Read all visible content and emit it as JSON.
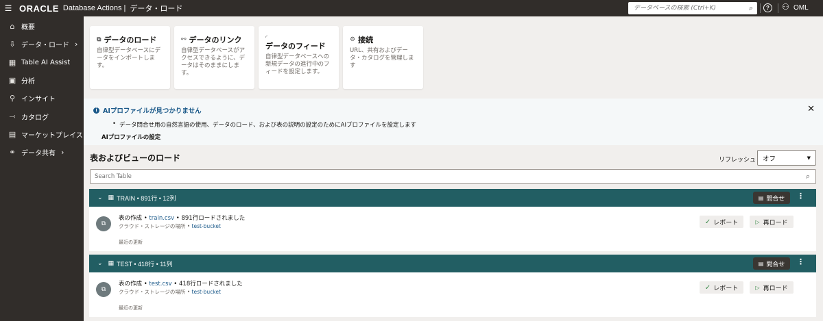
{
  "header": {
    "logo": "ORACLE",
    "product": "Database Actions |",
    "page": "データ・ロード",
    "search_placeholder": "データベースの検索 (Ctrl+K)",
    "user": "OML"
  },
  "sidebar": {
    "items": [
      {
        "label": "概要",
        "icon": "home-icon",
        "has_chevron": false
      },
      {
        "label": "データ・ロード",
        "icon": "data-load-icon",
        "has_chevron": true
      },
      {
        "label": "Table AI Assist",
        "icon": "table-ai-icon",
        "has_chevron": false
      },
      {
        "label": "分析",
        "icon": "analysis-icon",
        "has_chevron": false
      },
      {
        "label": "インサイト",
        "icon": "insight-icon",
        "has_chevron": false
      },
      {
        "label": "カタログ",
        "icon": "catalog-icon",
        "has_chevron": false
      },
      {
        "label": "マーケットプレイス",
        "icon": "marketplace-icon",
        "has_chevron": false
      },
      {
        "label": "データ共有",
        "icon": "share-icon",
        "has_chevron": true
      }
    ]
  },
  "cards": [
    {
      "title": "データのロード",
      "desc": "自律型データベースにデータをインポートします。",
      "icon": "load-icon"
    },
    {
      "title": "データのリンク",
      "desc": "自律型データベースがアクセスできるように、データはそのままにします。",
      "icon": "link-icon"
    },
    {
      "title": "データのフィード",
      "desc": "自律型データベースへの新規データの進行中のフィードを設定します。",
      "icon": "feed-icon"
    },
    {
      "title": "接続",
      "desc": "URL、共有およびデータ・カタログを管理します",
      "icon": "connection-icon"
    }
  ],
  "banner": {
    "title": "AIプロファイルが見つかりません",
    "item": "データ問合せ用の自然言語の使用、データのロード、および表の説明の設定のためにAIプロファイルを設定します",
    "link": "AIプロファイルの設定"
  },
  "section": {
    "title": "表およびビューのロード",
    "refresh_label": "リフレッシュ",
    "refresh_value": "オフ",
    "search_placeholder": "Search Table"
  },
  "tables": [
    {
      "title": "TRAIN • 891行 • 12列",
      "query_label": "問合せ",
      "line1_prefix": "表の作成 • ",
      "file": "train.csv",
      "line1_suffix": " • 891行ロードされました",
      "line2_prefix": "クラウド・ストレージの場所 • ",
      "bucket": "test-bucket",
      "line3": "最近の更新",
      "report_label": "レポート",
      "reload_label": "再ロード"
    },
    {
      "title": "TEST • 418行 • 11列",
      "query_label": "問合せ",
      "line1_prefix": "表の作成 • ",
      "file": "test.csv",
      "line1_suffix": " • 418行ロードされました",
      "line2_prefix": "クラウド・ストレージの場所 • ",
      "bucket": "test-bucket",
      "line3": "最近の更新",
      "report_label": "レポート",
      "reload_label": "再ロード"
    }
  ]
}
